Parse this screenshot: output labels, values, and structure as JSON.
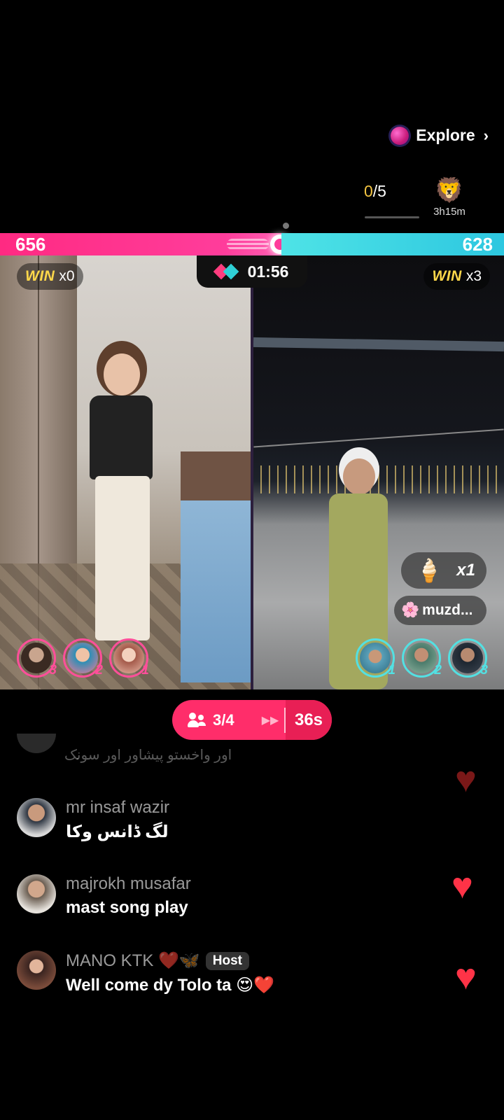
{
  "explore": {
    "label": "Explore"
  },
  "task": {
    "done": "0",
    "total": "/5"
  },
  "timer_badge": {
    "time": "3h15m"
  },
  "score": {
    "left": "656",
    "right": "628"
  },
  "win": {
    "left": {
      "label": "WIN",
      "count": "x0"
    },
    "right": {
      "label": "WIN",
      "count": "x3"
    }
  },
  "battle": {
    "timer": "01:56"
  },
  "gift": {
    "count": "x1"
  },
  "user_pill": {
    "name": "muzd..."
  },
  "supporters": {
    "left": [
      {
        "rank": "3"
      },
      {
        "rank": "2"
      },
      {
        "rank": "1"
      }
    ],
    "right": [
      {
        "rank": "1"
      },
      {
        "rank": "2"
      },
      {
        "rank": "3"
      }
    ]
  },
  "round": {
    "count": "3/4",
    "seconds": "36s"
  },
  "chat": {
    "partial_text": "اور واخستو پیشاور اور سونک",
    "messages": [
      {
        "name": "mr insaf wazir",
        "text": "لگ ڈانس وکا"
      },
      {
        "name": "majrokh musafar",
        "text": "mast song play"
      },
      {
        "name": "MANO KTK ❤️🦋",
        "badge": "Host",
        "text": "Well come dy Tolo ta 😍❤️"
      }
    ]
  },
  "colors": {
    "pink": "#ff2a82",
    "cyan": "#2dc7e0",
    "gold": "#ffd84a",
    "heart": "#ff3347"
  }
}
